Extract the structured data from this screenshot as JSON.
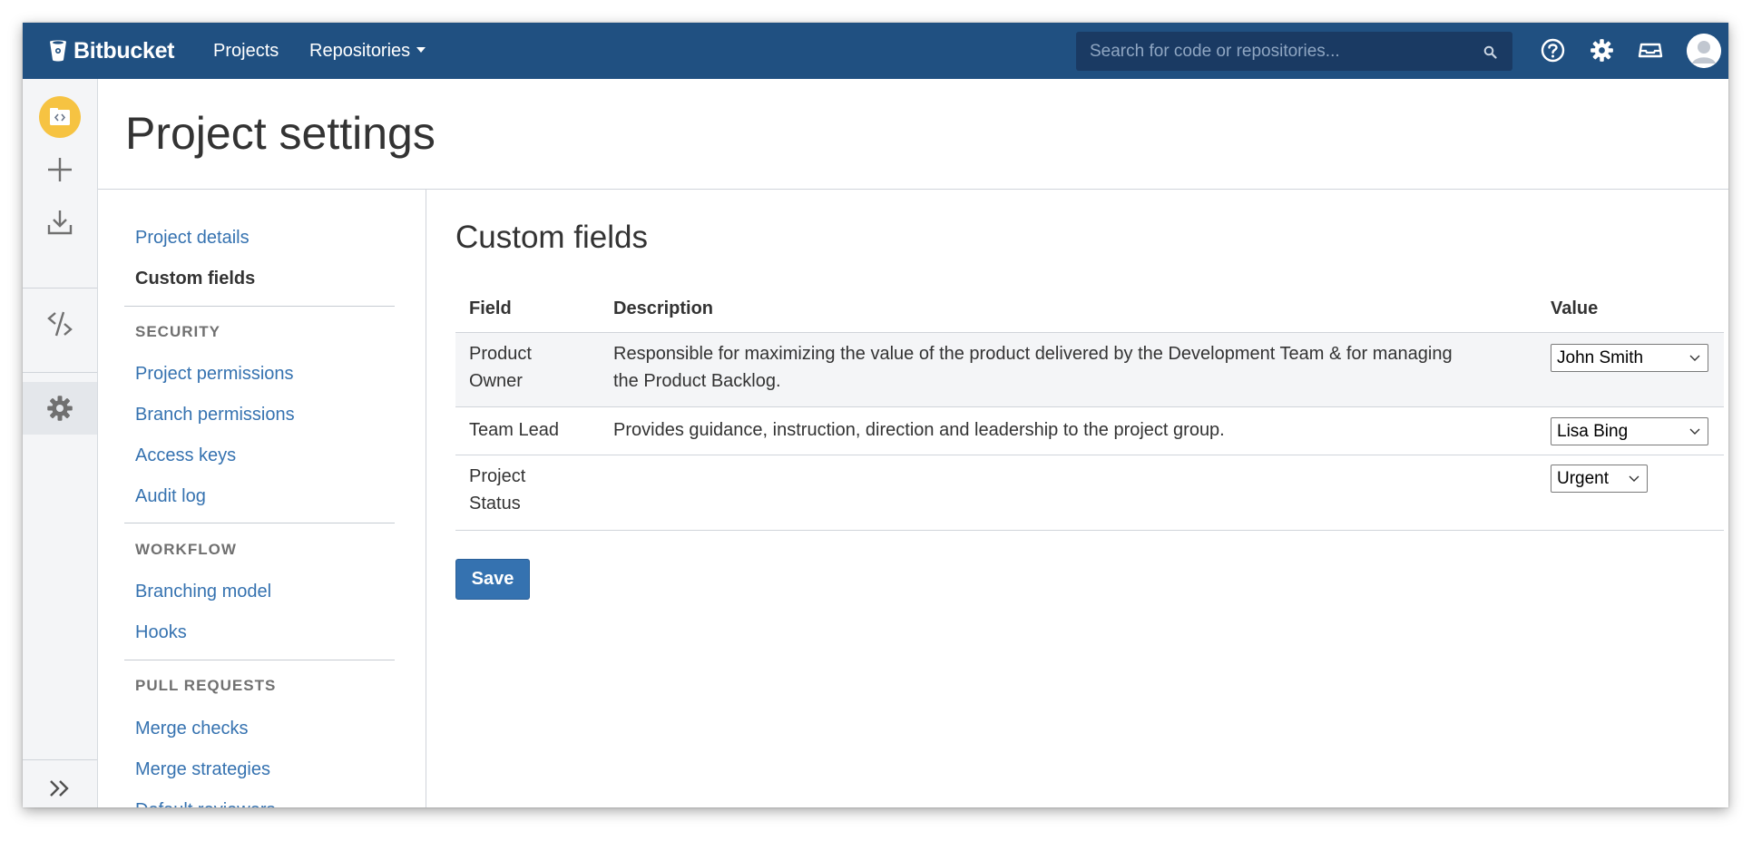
{
  "app": {
    "name": "Bitbucket"
  },
  "topnav": {
    "projects_label": "Projects",
    "repositories_label": "Repositories",
    "search_placeholder": "Search for code or repositories..."
  },
  "page": {
    "title": "Project settings"
  },
  "settings_nav": {
    "project_details": "Project details",
    "custom_fields": "Custom fields",
    "security_heading": "SECURITY",
    "project_permissions": "Project permissions",
    "branch_permissions": "Branch permissions",
    "access_keys": "Access keys",
    "audit_log": "Audit log",
    "workflow_heading": "WORKFLOW",
    "branching_model": "Branching model",
    "hooks": "Hooks",
    "pull_requests_heading": "PULL REQUESTS",
    "merge_checks": "Merge checks",
    "merge_strategies": "Merge strategies",
    "default_reviewers": "Default reviewers"
  },
  "content": {
    "title": "Custom fields",
    "columns": {
      "field": "Field",
      "description": "Description",
      "value": "Value"
    },
    "rows": [
      {
        "field_line1": "Product",
        "field_line2": "Owner",
        "desc_line1": "Responsible for maximizing the value of the product delivered by the Development Team & for managing",
        "desc_line2": "the Product Backlog.",
        "value": "John Smith"
      },
      {
        "field_line1": "Team Lead",
        "desc_line1": "Provides guidance, instruction, direction and leadership to the project group.",
        "value": "Lisa Bing"
      },
      {
        "field_line1": "Project",
        "field_line2": "Status",
        "value": "Urgent"
      }
    ],
    "save_label": "Save"
  },
  "colors": {
    "header_bg": "#205081",
    "link": "#3572b0",
    "button": "#3572b0",
    "project_avatar": "#f6c342"
  }
}
